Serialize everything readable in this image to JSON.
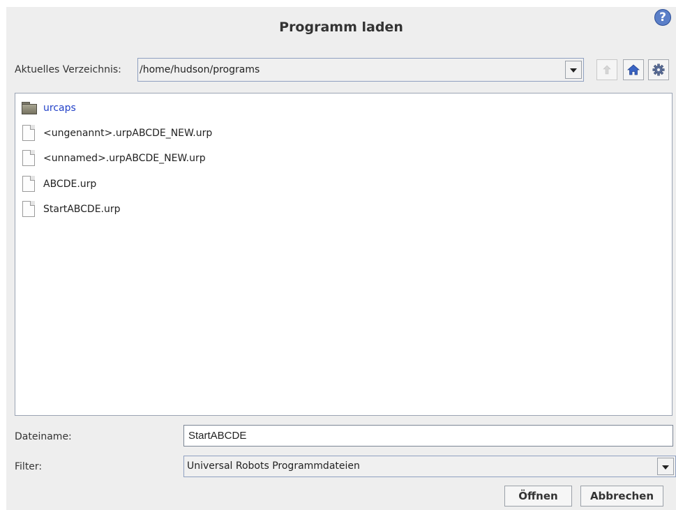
{
  "dialog": {
    "title": "Programm laden",
    "help_icon": "question-mark-icon",
    "help_glyph": "?"
  },
  "directory": {
    "label": "Aktuelles Verzeichnis:",
    "value": "/home/hudson/programs",
    "buttons": [
      "arrow-up-icon",
      "home-icon",
      "gear-icon"
    ]
  },
  "files": [
    {
      "name": "urcaps",
      "type": "folder",
      "icon": "folder-icon"
    },
    {
      "name": "<ungenannt>.urpABCDE_NEW.urp",
      "type": "file",
      "icon": "file-icon"
    },
    {
      "name": "<unnamed>.urpABCDE_NEW.urp",
      "type": "file",
      "icon": "file-icon"
    },
    {
      "name": "ABCDE.urp",
      "type": "file",
      "icon": "file-icon"
    },
    {
      "name": "StartABCDE.urp",
      "type": "file",
      "icon": "file-icon"
    }
  ],
  "filename": {
    "label": "Dateiname:",
    "value": "StartABCDE"
  },
  "filter": {
    "label": "Filter:",
    "value": "Universal Robots Programmdateien"
  },
  "actions": {
    "open_label": "Öffnen",
    "cancel_label": "Abbrechen"
  },
  "colors": {
    "folder_link": "#2241c8",
    "help_blue": "#5b7fc8",
    "home_icon": "#3a64c4"
  }
}
